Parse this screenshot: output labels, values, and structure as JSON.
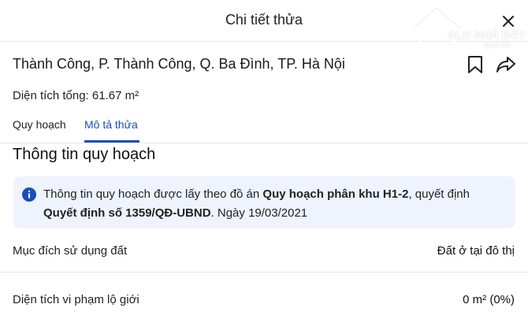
{
  "header": {
    "title": "Chi tiết thửa"
  },
  "watermark": {
    "brand": "ALO NHÀ ĐẤT",
    "domain": ".com.vn"
  },
  "parcel": {
    "address": "Thành Công, P. Thành Công, Q. Ba Đình, TP. Hà Nội",
    "area_label": "Diện tích tổng:",
    "area_value": "61.67 m²"
  },
  "tabs": [
    {
      "label": "Quy hoạch",
      "active": false
    },
    {
      "label": "Mô tả thửa",
      "active": true
    }
  ],
  "colors": {
    "accent": "#1a4fb8",
    "info_bg": "#eef3fe",
    "divider": "#e6e6e6"
  },
  "planning": {
    "section_title": "Thông tin quy hoạch",
    "info": {
      "prefix": "Thông tin quy hoạch được lấy theo đồ án",
      "plan_name": "Quy hoạch phân khu H1-2",
      "middle": ", quyết định",
      "decision": "Quyết định số 1359/QĐ-UBND",
      "suffix": ". Ngày 19/03/2021"
    },
    "rows": [
      {
        "label": "Mục đích sử dụng đất",
        "value": "Đất ở tại đô thị"
      },
      {
        "label": "Diện tích vi phạm lộ giới",
        "value": "0 m² (0%)"
      }
    ]
  },
  "icons": {
    "close": "close-icon",
    "bookmark": "bookmark-icon",
    "share": "share-icon",
    "info": "info-icon",
    "watermark_house": "house-logo-icon"
  }
}
